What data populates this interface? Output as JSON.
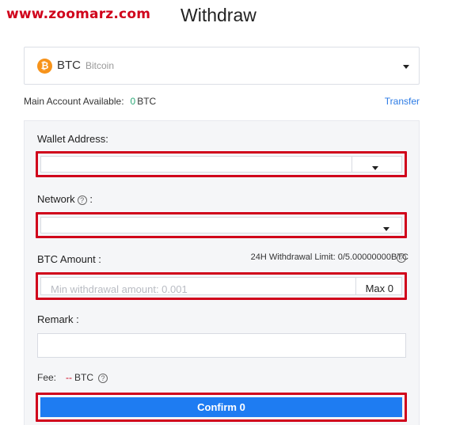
{
  "watermark": "www.zoomarz.com",
  "page_title": "Withdraw",
  "coin_selector": {
    "icon": "bitcoin-icon",
    "icon_glyph": "₿",
    "symbol": "BTC",
    "name": "Bitcoin"
  },
  "balance": {
    "label": "Main Account Available:",
    "value": "0",
    "unit": "BTC",
    "transfer_label": "Transfer"
  },
  "form": {
    "wallet_address_label": "Wallet Address:",
    "network_label": "Network",
    "network_label_suffix": ":",
    "amount_label": "BTC Amount :",
    "withdrawal_limit": "24H Withdrawal Limit: 0/5.00000000BTC",
    "amount_placeholder": "Min withdrawal amount:  0.001",
    "max_label": "Max 0",
    "remark_label": "Remark :",
    "fee_label": "Fee:",
    "fee_value": "--",
    "fee_unit": "BTC",
    "confirm_label": "Confirm 0",
    "help_glyph": "?"
  },
  "colors": {
    "highlight": "#d0021b",
    "primary_button": "#1e7cf2",
    "bitcoin": "#f7931a",
    "available_value": "#2aa876",
    "link": "#2c7be5"
  }
}
